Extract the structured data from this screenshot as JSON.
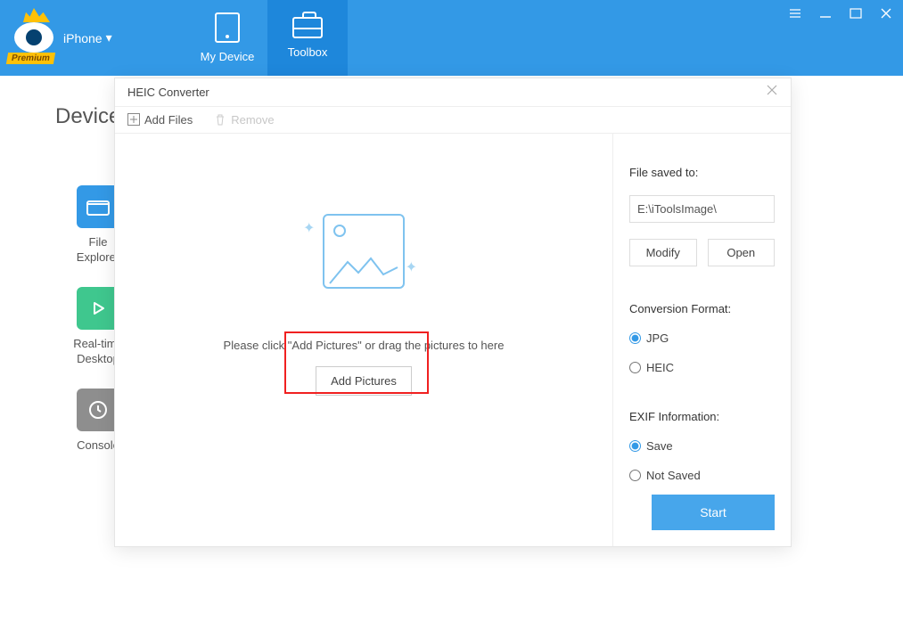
{
  "header": {
    "device_label": "iPhone",
    "premium_badge": "Premium",
    "tabs": {
      "my_device": "My Device",
      "toolbox": "Toolbox"
    }
  },
  "background": {
    "page_heading": "Device",
    "sidebar": [
      {
        "label": "File\nExplorer"
      },
      {
        "label": "Real-time\nDesktop"
      },
      {
        "label": "Console"
      }
    ]
  },
  "modal": {
    "title": "HEIC Converter",
    "toolbar": {
      "add_files": "Add Files",
      "remove": "Remove"
    },
    "drop": {
      "hint": "Please click \"Add Pictures\" or drag the pictures to here",
      "add_button": "Add Pictures"
    },
    "panel": {
      "saved_label": "File saved to:",
      "saved_path": "E:\\iToolsImage\\",
      "modify": "Modify",
      "open": "Open",
      "format_label": "Conversion Format:",
      "format_jpg": "JPG",
      "format_heic": "HEIC",
      "exif_label": "EXIF Information:",
      "exif_save": "Save",
      "exif_notsaved": "Not Saved",
      "start": "Start"
    }
  }
}
